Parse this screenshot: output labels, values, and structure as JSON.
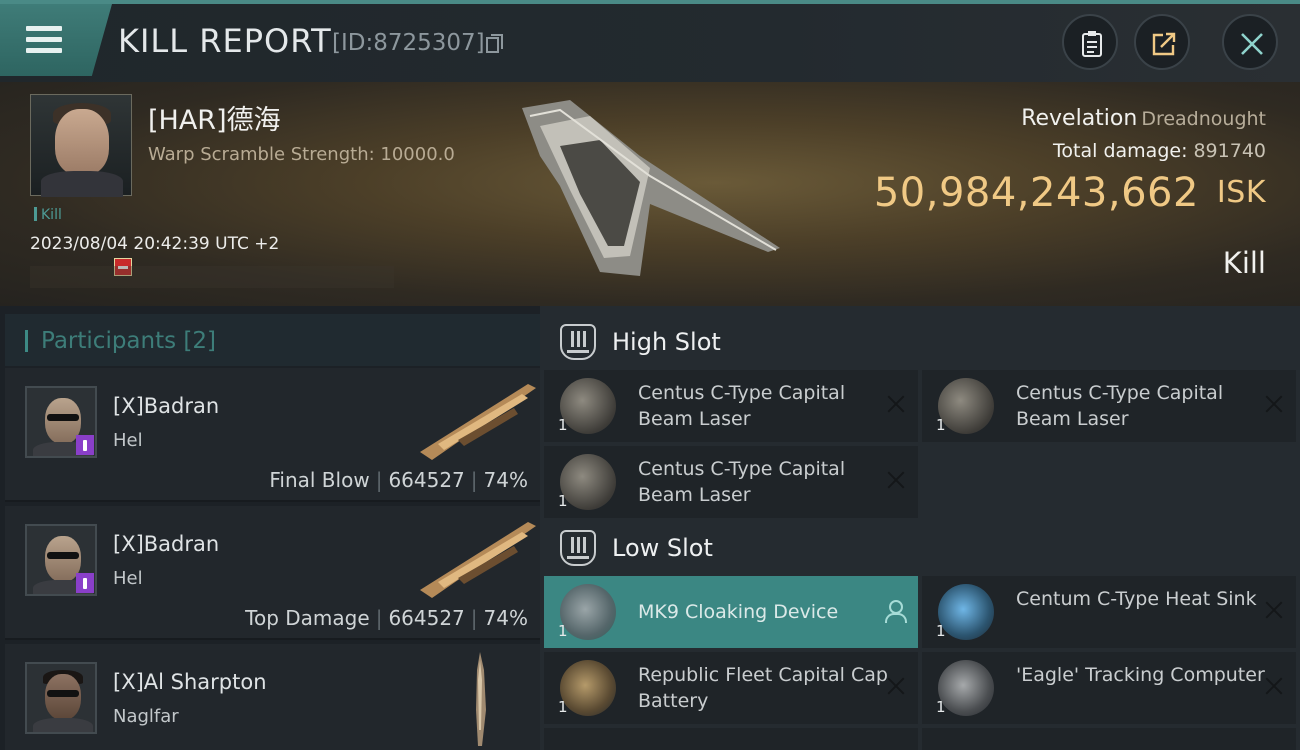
{
  "header": {
    "title": "KILL REPORT",
    "report_id": "[ID:8725307]"
  },
  "victim": {
    "name": "[HAR]德海",
    "warp_scramble": "Warp Scramble Strength: 10000.0",
    "kill_tag": "Kill",
    "datetime": "2023/08/04 20:42:39 UTC +2",
    "ship_name": "Revelation",
    "ship_class": "Dreadnought",
    "total_damage_label": "Total damage:",
    "total_damage_value": "891740",
    "isk_value": "50,984,243,662",
    "isk_unit": "ISK",
    "outcome": "Kill"
  },
  "participants": {
    "title": "Participants [2]",
    "rows": [
      {
        "name": "[X]Badran",
        "ship": "Hel",
        "role": "Final Blow",
        "damage": "664527",
        "percent": "74%"
      },
      {
        "name": "[X]Badran",
        "ship": "Hel",
        "role": "Top Damage",
        "damage": "664527",
        "percent": "74%"
      },
      {
        "name": "[X]Al Sharpton",
        "ship": "Naglfar"
      }
    ]
  },
  "slots": {
    "high_title": "High Slot",
    "low_title": "Low Slot",
    "high": [
      {
        "name": "Centus C-Type Capital Beam Laser",
        "qty": "1"
      },
      {
        "name": "Centus C-Type Capital Beam Laser",
        "qty": "1"
      },
      {
        "name": "Centus C-Type Capital Beam Laser",
        "qty": "1"
      }
    ],
    "low": [
      {
        "name": "MK9 Cloaking Device",
        "qty": "1"
      },
      {
        "name": "Centum C-Type Heat Sink",
        "qty": "1"
      },
      {
        "name": "Republic Fleet Capital Cap Battery",
        "qty": "1"
      },
      {
        "name": "'Eagle' Tracking Computer",
        "qty": "1"
      }
    ]
  },
  "colors": {
    "accent": "#3b8783",
    "isk": "#f0c985",
    "loss_badge": "#c82b2b",
    "participant_badge": "#8a3fc9"
  },
  "icons": [
    "menu-icon",
    "copy-icon",
    "clipboard-icon",
    "share-icon",
    "close-icon",
    "slot-icon",
    "remove-icon",
    "person-icon"
  ]
}
